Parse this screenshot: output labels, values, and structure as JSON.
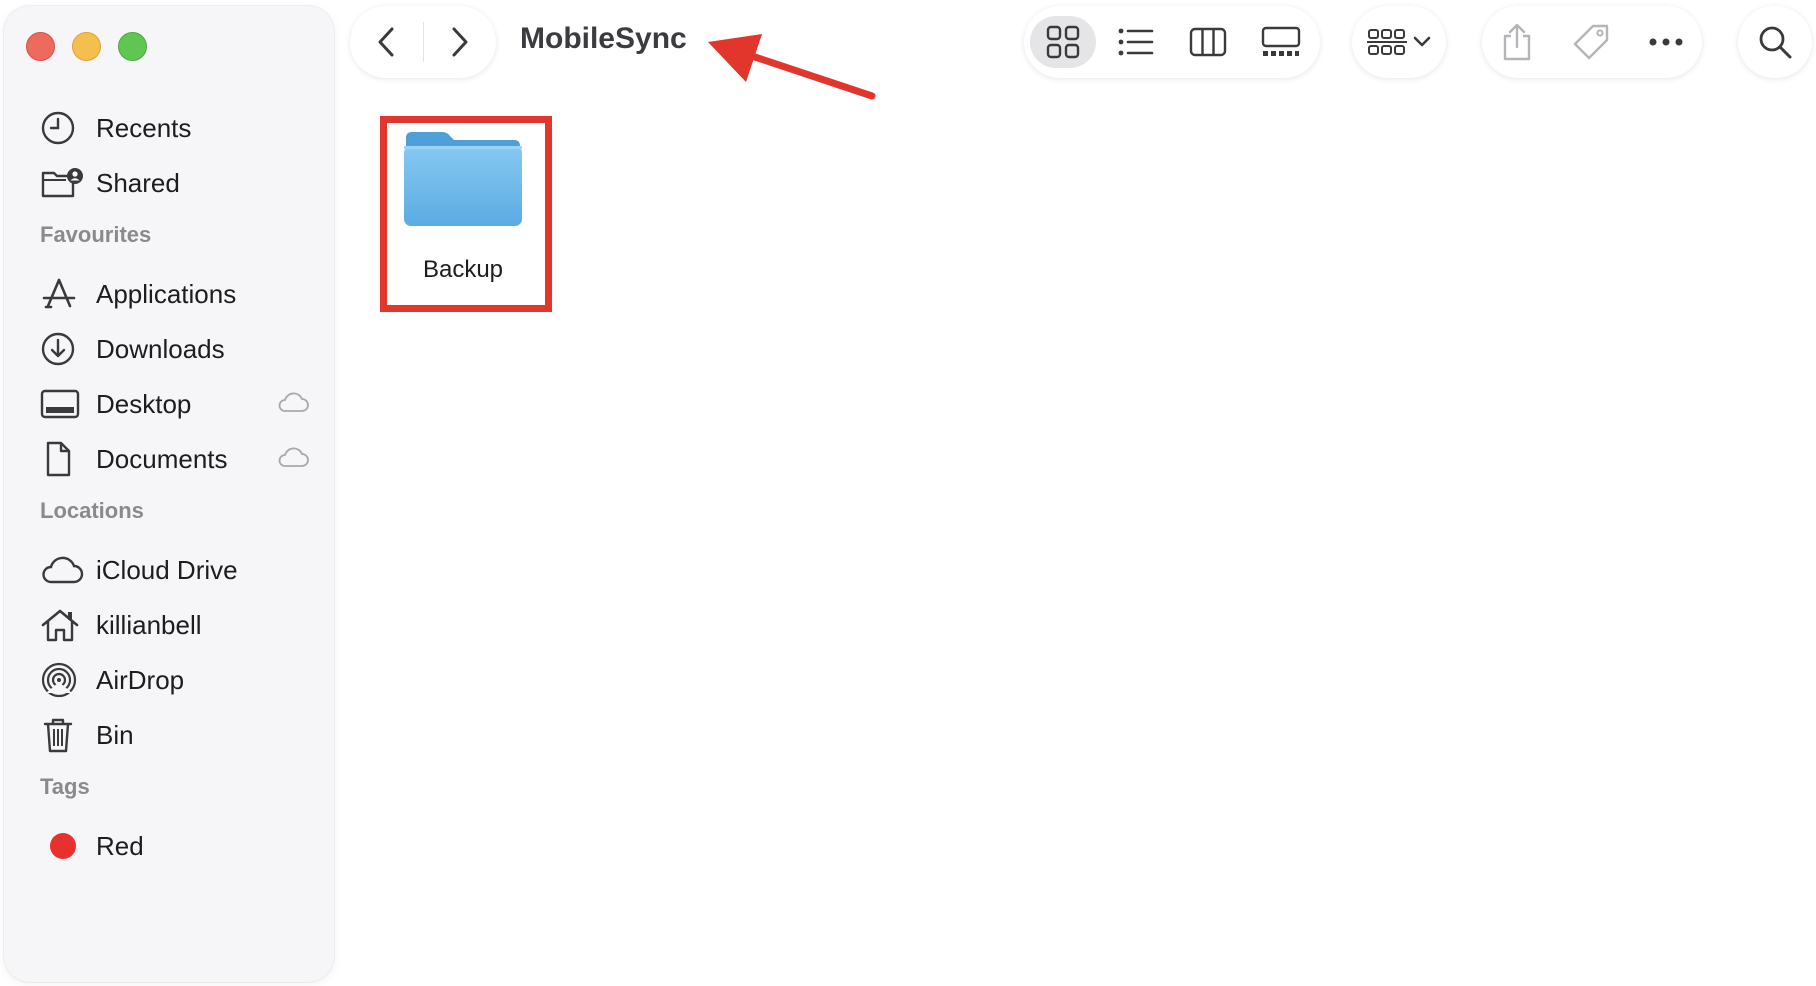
{
  "window": {
    "title": "MobileSync"
  },
  "sidebar": {
    "top_items": [
      {
        "label": "Recents",
        "icon": "clock-icon"
      },
      {
        "label": "Shared",
        "icon": "shared-folder-icon"
      }
    ],
    "sections": [
      {
        "title": "Favourites",
        "items": [
          {
            "label": "Applications",
            "icon": "applications-icon"
          },
          {
            "label": "Downloads",
            "icon": "download-icon"
          },
          {
            "label": "Desktop",
            "icon": "desktop-icon",
            "icloud": true
          },
          {
            "label": "Documents",
            "icon": "document-icon",
            "icloud": true
          }
        ]
      },
      {
        "title": "Locations",
        "items": [
          {
            "label": "iCloud Drive",
            "icon": "icloud-icon"
          },
          {
            "label": "killianbell",
            "icon": "home-icon"
          },
          {
            "label": "AirDrop",
            "icon": "airdrop-icon"
          },
          {
            "label": "Bin",
            "icon": "trash-icon"
          }
        ]
      },
      {
        "title": "Tags",
        "items": [
          {
            "label": "Red",
            "icon": "tag-dot",
            "color": "#e8302f"
          }
        ]
      }
    ]
  },
  "toolbar": {
    "active_view": "icon-view",
    "views": [
      "icon-view",
      "list-view",
      "column-view",
      "gallery-view"
    ]
  },
  "content": {
    "items": [
      {
        "name": "Backup",
        "type": "folder",
        "highlighted": true
      }
    ]
  },
  "colors": {
    "annotation_red": "#e2352b",
    "folder_blue": "#6cb9ec",
    "sidebar_bg": "#f6f6f8"
  }
}
